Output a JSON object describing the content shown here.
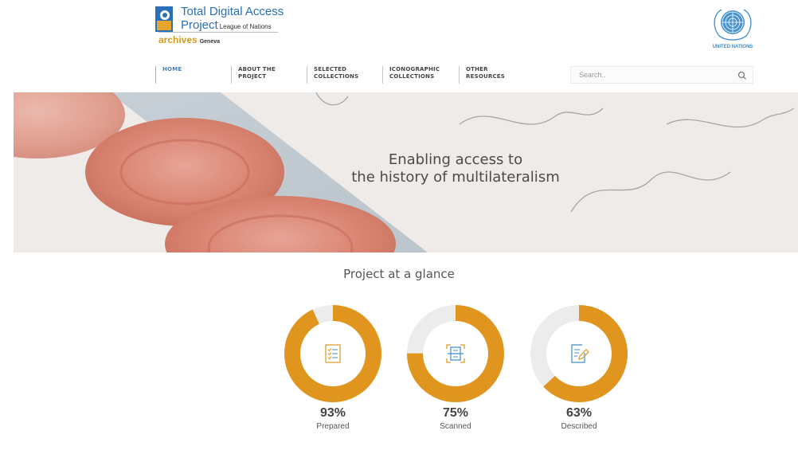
{
  "header": {
    "logo": {
      "line1": "Total Digital Access",
      "line2": "Project",
      "line2_small": "League of Nations",
      "line3": "archives",
      "line3_small": "Geneva"
    },
    "un_logo": {
      "label": "UNITED NATIONS"
    }
  },
  "nav": {
    "items": [
      {
        "label": "HOME",
        "active": true
      },
      {
        "label": "ABOUT THE\nPROJECT"
      },
      {
        "label": "SELECTED\nCOLLECTIONS"
      },
      {
        "label": "ICONOGRAPHIC\nCOLLECTIONS"
      },
      {
        "label": "OTHER\nRESOURCES"
      }
    ]
  },
  "search": {
    "placeholder": "Search..",
    "icon": "search-icon"
  },
  "hero": {
    "line1": "Enabling access to",
    "line2": "the history of multilateralism"
  },
  "stats": {
    "title": "Project at a glance",
    "accent_color": "#e0961e",
    "track_color": "#ececec",
    "items": [
      {
        "value": 0.93,
        "percent_label": "93%",
        "label": "Prepared",
        "icon": "checklist-icon"
      },
      {
        "value": 0.75,
        "percent_label": "75%",
        "label": "Scanned",
        "icon": "scan-document-icon"
      },
      {
        "value": 0.63,
        "percent_label": "63%",
        "label": "Described",
        "icon": "edit-document-icon"
      }
    ]
  }
}
